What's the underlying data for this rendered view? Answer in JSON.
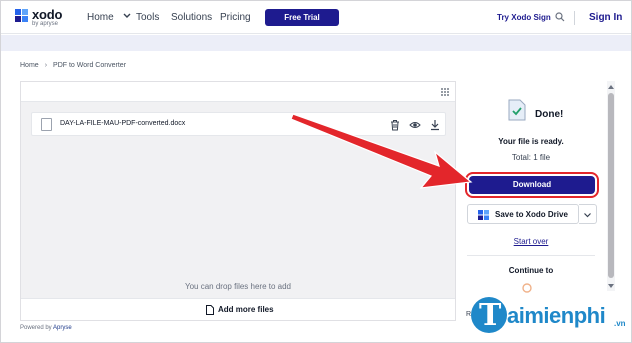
{
  "header": {
    "logo_name": "xodo",
    "logo_sub": "by apryse",
    "nav": [
      "Home",
      "Tools",
      "Solutions",
      "Pricing"
    ],
    "trial_label": "Free Trial",
    "try_sign_label": "Try Xodo Sign",
    "signin_label": "Sign In"
  },
  "breadcrumb": [
    "Home",
    "PDF to Word Converter"
  ],
  "files": {
    "name": "DAY-LA-FILE-MAU-PDF-converted.docx",
    "drop_hint": "You can drop files here to add",
    "add_more_label": "Add more files"
  },
  "powered": {
    "prefix": "Powered by",
    "brand": "Apryse"
  },
  "result": {
    "done_label": "Done!",
    "ready_text": "Your file is ready.",
    "total_text": "Total: 1 file",
    "download_label": "Download",
    "save_label": "Save to Xodo Drive",
    "start_over_label": "Start over",
    "continue_label": "Continue to",
    "partial_text": "Ra"
  },
  "watermark": {
    "letter": "T",
    "text": "aimienphi",
    "suffix": ".vn"
  },
  "colors": {
    "brand": "#1e1b8f",
    "highlight": "#e3262b",
    "watermark": "#1f88c9"
  },
  "icons": [
    "xodo-logo-icon",
    "chevron-down-icon",
    "search-icon",
    "grid-icon",
    "file-icon",
    "trash-icon",
    "eye-icon",
    "download-icon",
    "document-icon",
    "done-file-icon",
    "drive-icon",
    "chevron-down-icon",
    "arrow-icon"
  ]
}
